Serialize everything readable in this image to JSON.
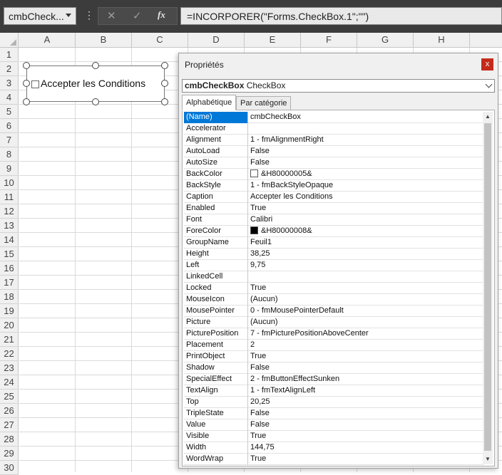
{
  "formula_bar": {
    "name_box": "cmbCheck...",
    "more_dots": "⋮",
    "cancel": "✕",
    "confirm": "✓",
    "fx": "fx",
    "formula": "=INCORPORER(\"Forms.CheckBox.1\";\"\")"
  },
  "columns": [
    "A",
    "B",
    "C",
    "D",
    "E",
    "F",
    "G",
    "H"
  ],
  "rows": [
    "1",
    "2",
    "3",
    "4",
    "5",
    "6",
    "7",
    "8",
    "9",
    "10",
    "11",
    "12",
    "13",
    "14",
    "15",
    "16",
    "17",
    "18",
    "19",
    "20",
    "21",
    "22",
    "23",
    "24",
    "25",
    "26",
    "27",
    "28",
    "29",
    "30"
  ],
  "checkbox_control": {
    "label": "Accepter les Conditions"
  },
  "properties": {
    "title": "Propriétés",
    "close": "x",
    "object_name": "cmbCheckBox",
    "object_type": "CheckBox",
    "tabs": [
      "Alphabétique",
      "Par catégorie"
    ],
    "rows": [
      {
        "name": "(Name)",
        "value": "cmbCheckBox"
      },
      {
        "name": "Accelerator",
        "value": ""
      },
      {
        "name": "Alignment",
        "value": "1 - fmAlignmentRight"
      },
      {
        "name": "AutoLoad",
        "value": "False"
      },
      {
        "name": "AutoSize",
        "value": "False"
      },
      {
        "name": "BackColor",
        "value": "&H80000005&",
        "swatch": "#ffffff"
      },
      {
        "name": "BackStyle",
        "value": "1 - fmBackStyleOpaque"
      },
      {
        "name": "Caption",
        "value": "Accepter les Conditions"
      },
      {
        "name": "Enabled",
        "value": "True"
      },
      {
        "name": "Font",
        "value": "Calibri"
      },
      {
        "name": "ForeColor",
        "value": "&H80000008&",
        "swatch": "#000000"
      },
      {
        "name": "GroupName",
        "value": "Feuil1"
      },
      {
        "name": "Height",
        "value": "38,25"
      },
      {
        "name": "Left",
        "value": "9,75"
      },
      {
        "name": "LinkedCell",
        "value": ""
      },
      {
        "name": "Locked",
        "value": "True"
      },
      {
        "name": "MouseIcon",
        "value": "(Aucun)"
      },
      {
        "name": "MousePointer",
        "value": "0 - fmMousePointerDefault"
      },
      {
        "name": "Picture",
        "value": "(Aucun)"
      },
      {
        "name": "PicturePosition",
        "value": "7 - fmPicturePositionAboveCenter"
      },
      {
        "name": "Placement",
        "value": "2"
      },
      {
        "name": "PrintObject",
        "value": "True"
      },
      {
        "name": "Shadow",
        "value": "False"
      },
      {
        "name": "SpecialEffect",
        "value": "2 - fmButtonEffectSunken"
      },
      {
        "name": "TextAlign",
        "value": "1 - fmTextAlignLeft"
      },
      {
        "name": "Top",
        "value": "20,25"
      },
      {
        "name": "TripleState",
        "value": "False"
      },
      {
        "name": "Value",
        "value": "False"
      },
      {
        "name": "Visible",
        "value": "True"
      },
      {
        "name": "Width",
        "value": "144,75"
      },
      {
        "name": "WordWrap",
        "value": "True"
      }
    ]
  },
  "colors": {
    "selection": "#0078d7",
    "close_button": "#c42b1c",
    "formula_bar_bg": "#3c3c3c"
  }
}
